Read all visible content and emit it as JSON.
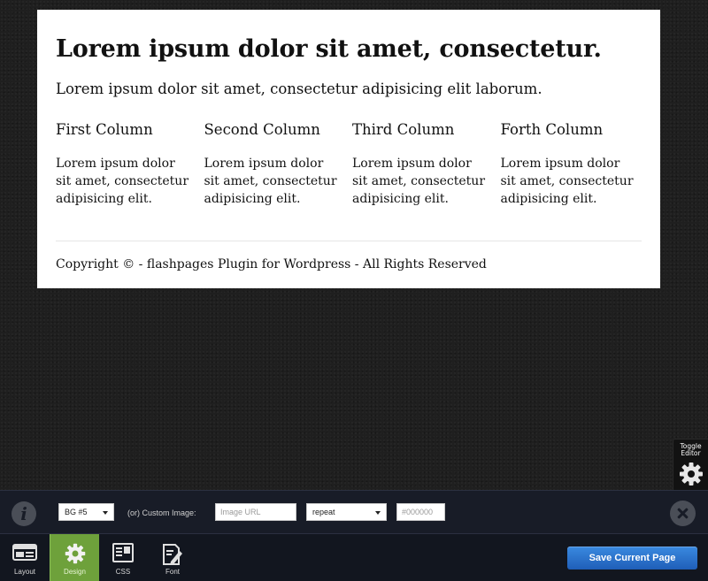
{
  "preview": {
    "title": "Lorem ipsum dolor sit amet, consectetur.",
    "lead": "Lorem ipsum dolor sit amet, consectetur adipisicing elit laborum.",
    "columns": [
      {
        "heading": "First Column",
        "text": "Lorem ipsum dolor sit amet, consectetur adipisicing elit."
      },
      {
        "heading": "Second Column",
        "text": "Lorem ipsum dolor sit amet, consectetur adipisicing elit."
      },
      {
        "heading": "Third Column",
        "text": "Lorem ipsum dolor sit amet, consectetur adipisicing elit."
      },
      {
        "heading": "Forth Column",
        "text": "Lorem ipsum dolor sit amet, consectetur adipisicing elit."
      }
    ],
    "footer": "Copyright © - flashpages Plugin for Wordpress - All Rights Reserved"
  },
  "toggle_editor": {
    "line1": "Toggle",
    "line2": "Editor",
    "icon": "gear-icon"
  },
  "editor_bar": {
    "info_icon": "info-icon",
    "bg_select_value": "BG #5",
    "custom_image_label": "(or) Custom Image:",
    "image_url_placeholder": "Image URL",
    "repeat_select_value": "repeat",
    "color_placeholder": "#000000",
    "close_icon": "close-icon"
  },
  "toolbar": {
    "tabs": [
      {
        "label": "Layout",
        "icon": "layout-icon",
        "active": false
      },
      {
        "label": "Design",
        "icon": "gear-icon",
        "active": true
      },
      {
        "label": "CSS",
        "icon": "css-icon",
        "active": false
      },
      {
        "label": "Font",
        "icon": "font-edit-icon",
        "active": false
      }
    ],
    "save_label": "Save Current Page"
  },
  "colors": {
    "accent_active": "#6ea13b",
    "save_button": "#2a72d0",
    "background": "#1f1f1f"
  }
}
